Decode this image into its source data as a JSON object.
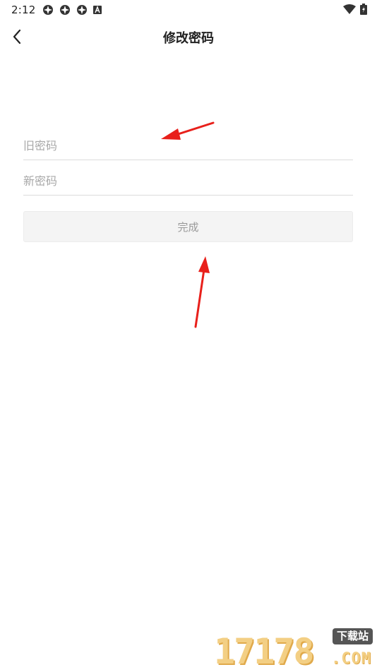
{
  "status_bar": {
    "time": "2:12",
    "left_icons": [
      "app-notification-icon",
      "app-notification-icon",
      "app-notification-icon",
      "keyboard-a-icon"
    ],
    "right_icons": [
      "wifi-icon",
      "battery-charging-icon"
    ]
  },
  "header": {
    "title": "修改密码",
    "back_icon": "chevron-left-icon"
  },
  "form": {
    "old_password": {
      "placeholder": "旧密码",
      "value": ""
    },
    "new_password": {
      "placeholder": "新密码",
      "value": ""
    },
    "submit_label": "完成"
  },
  "watermark": {
    "digits": "17178",
    "tag": "下载站",
    "domain": ".COM"
  },
  "colors": {
    "annotation_arrow": "#e8201b",
    "button_bg": "#f4f4f4",
    "button_text": "#9a9a9a",
    "placeholder": "#a8a8a8",
    "divider": "#dcdcdc",
    "watermark": "#f3cf84"
  }
}
